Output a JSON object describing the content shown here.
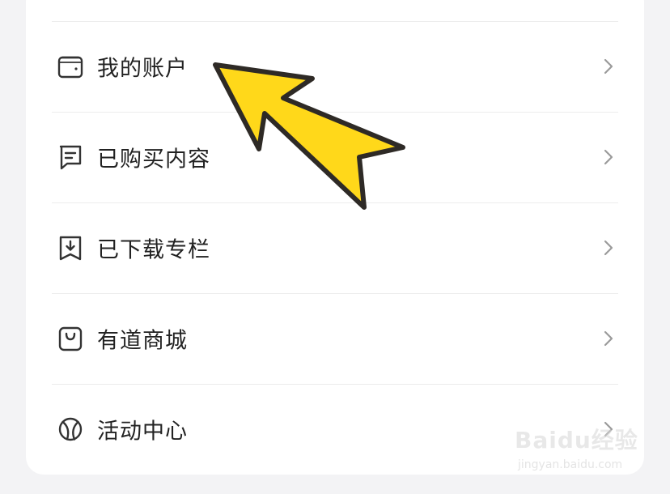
{
  "menu": {
    "items": [
      {
        "label": "我的账户",
        "icon": "wallet-icon"
      },
      {
        "label": "已购买内容",
        "icon": "receipt-icon"
      },
      {
        "label": "已下载专栏",
        "icon": "download-icon"
      },
      {
        "label": "有道商城",
        "icon": "shopping-bag-icon"
      },
      {
        "label": "活动中心",
        "icon": "ball-icon"
      }
    ]
  },
  "overlay": {
    "annotation": "arrow-pointer",
    "arrow_color": "#FFD81A"
  },
  "watermark": {
    "brand": "Baidu经验",
    "url": "jingyan.baidu.com"
  }
}
